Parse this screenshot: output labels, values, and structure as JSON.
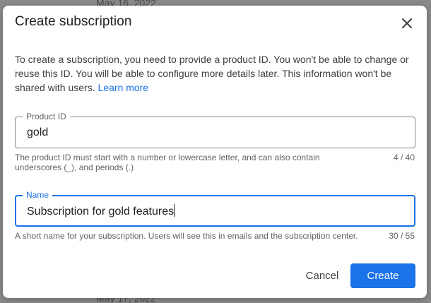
{
  "background": {
    "date_top": "May 16, 2022",
    "date_bottom": "May 17, 2022"
  },
  "dialog": {
    "title": "Create subscription",
    "close_icon": "close-icon",
    "description": "To create a subscription, you need to provide a product ID. You won't be able to change or reuse this ID. You will be able to configure more details later. This information won't be shared with users.",
    "learn_more": "Learn more"
  },
  "product_id": {
    "label": "Product ID",
    "value": "gold",
    "hint": "The product ID must start with a number or lowercase letter, and can also contain underscores (_), and periods (.)",
    "counter": "4 / 40"
  },
  "name": {
    "label": "Name",
    "value": "Subscription for gold features",
    "hint": "A short name for your subscription. Users will see this in emails and the subscription center.",
    "counter": "30 / 55",
    "focused": true
  },
  "actions": {
    "cancel": "Cancel",
    "create": "Create"
  },
  "colors": {
    "accent": "#1a73e8",
    "text_primary": "#202124",
    "text_secondary": "#5f6368"
  }
}
